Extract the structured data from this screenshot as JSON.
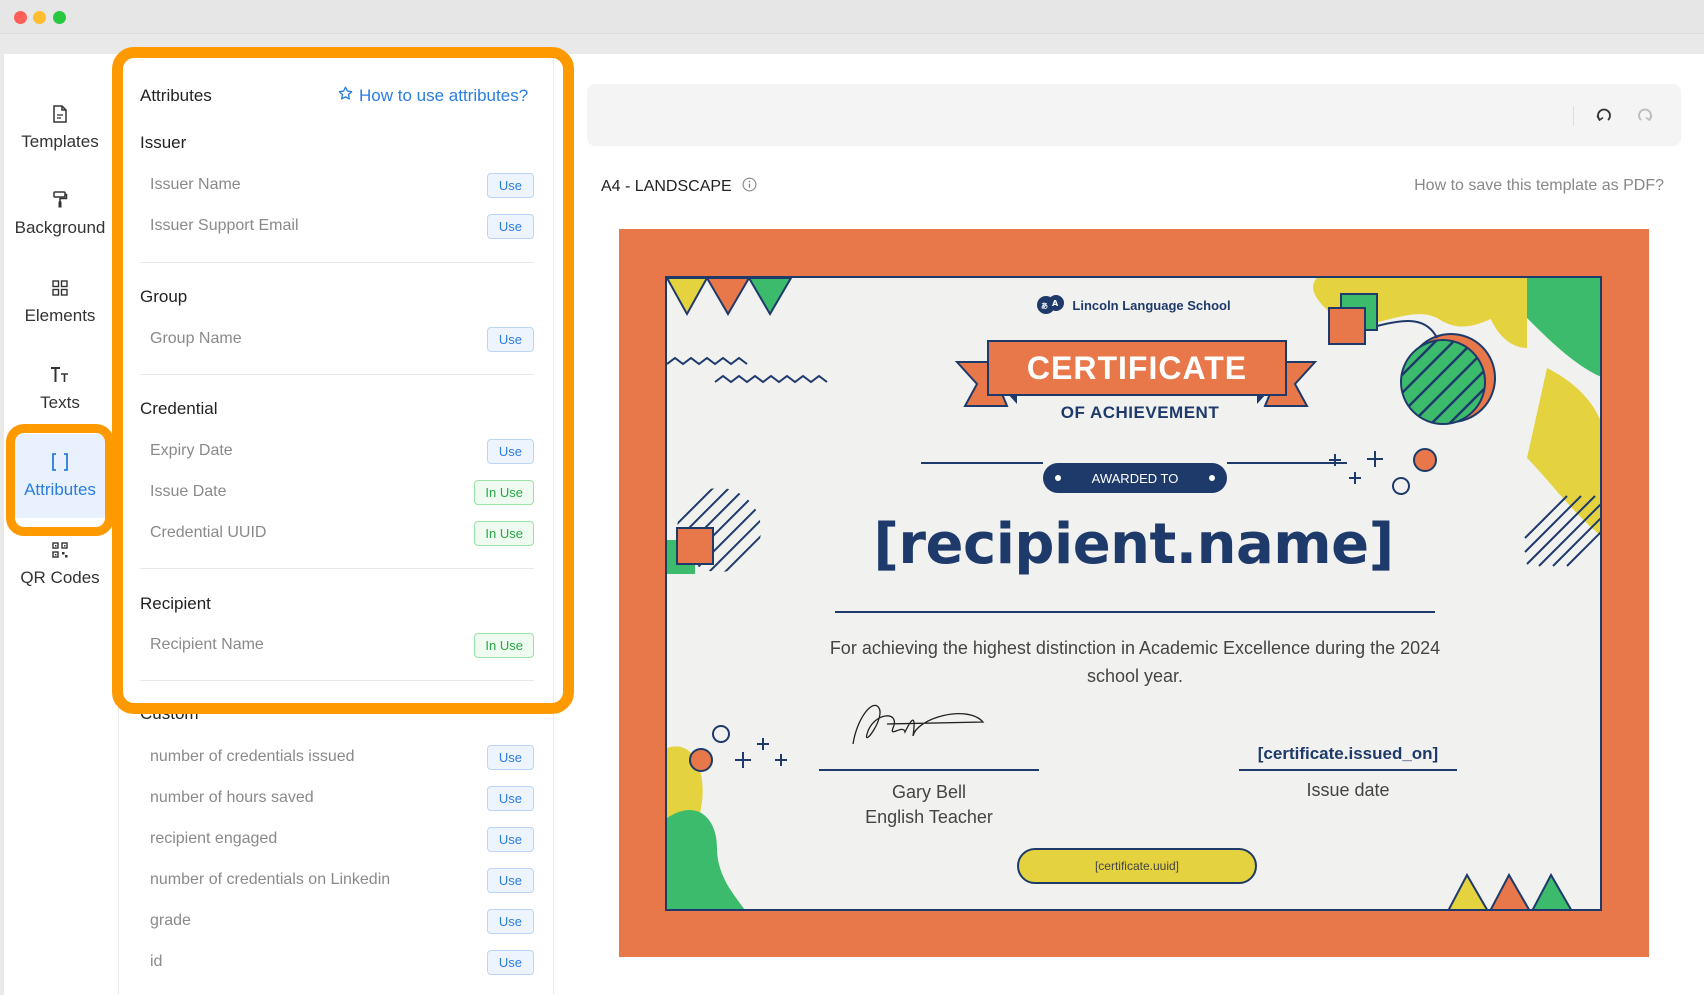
{
  "window": {
    "buttons": [
      "close",
      "minimize",
      "zoom"
    ]
  },
  "rail": {
    "items": [
      {
        "label": "Templates",
        "icon": "file-icon"
      },
      {
        "label": "Background",
        "icon": "paint-roller-icon"
      },
      {
        "label": "Elements",
        "icon": "grid-icon"
      },
      {
        "label": "Texts",
        "icon": "text-icon"
      },
      {
        "label": "Attributes",
        "icon": "brackets-icon",
        "active": true
      },
      {
        "label": "QR Codes",
        "icon": "qr-icon"
      }
    ]
  },
  "panel": {
    "title": "Attributes",
    "help_link": "How to use attributes?",
    "use_label": "Use",
    "in_use_label": "In Use",
    "sections": [
      {
        "title": "Issuer",
        "items": [
          {
            "name": "Issuer Name",
            "status": "Use"
          },
          {
            "name": "Issuer Support Email",
            "status": "Use"
          }
        ]
      },
      {
        "title": "Group",
        "items": [
          {
            "name": "Group Name",
            "status": "Use"
          }
        ]
      },
      {
        "title": "Credential",
        "items": [
          {
            "name": "Expiry Date",
            "status": "Use"
          },
          {
            "name": "Issue Date",
            "status": "In Use"
          },
          {
            "name": "Credential UUID",
            "status": "In Use"
          }
        ]
      },
      {
        "title": "Recipient",
        "items": [
          {
            "name": "Recipient Name",
            "status": "In Use"
          }
        ]
      },
      {
        "title": "Custom",
        "items": [
          {
            "name": "number of credentials issued",
            "status": "Use"
          },
          {
            "name": "number of hours saved",
            "status": "Use"
          },
          {
            "name": "recipient engaged",
            "status": "Use"
          },
          {
            "name": "number of credentials on Linkedin",
            "status": "Use"
          },
          {
            "name": "grade",
            "status": "Use"
          },
          {
            "name": "id",
            "status": "Use"
          }
        ]
      }
    ]
  },
  "main": {
    "page_size": "A4 - LANDSCAPE",
    "pdf_help": "How to save this template as PDF?"
  },
  "certificate": {
    "school": "Lincoln Language School",
    "title": "CERTIFICATE",
    "subtitle": "OF ACHIEVEMENT",
    "awarded_to": "AWARDED TO",
    "recipient_var": "[recipient.name]",
    "description": "For achieving the highest distinction in Academic Excellence during the 2024 school year.",
    "signer_name": "Gary Bell",
    "signer_role": "English Teacher",
    "issued_var": "[certificate.issued_on]",
    "issued_label": "Issue date",
    "uuid_var": "[certificate.uuid]",
    "colors": {
      "frame": "#e8774a",
      "navy": "#1e3a6a",
      "yellow": "#e4d33e",
      "green": "#3dbb6c",
      "paper": "#f1f1f0"
    }
  },
  "colors": {
    "accent": "#2a7de1",
    "highlight": "#ff9900",
    "in_use": "#28a745"
  }
}
